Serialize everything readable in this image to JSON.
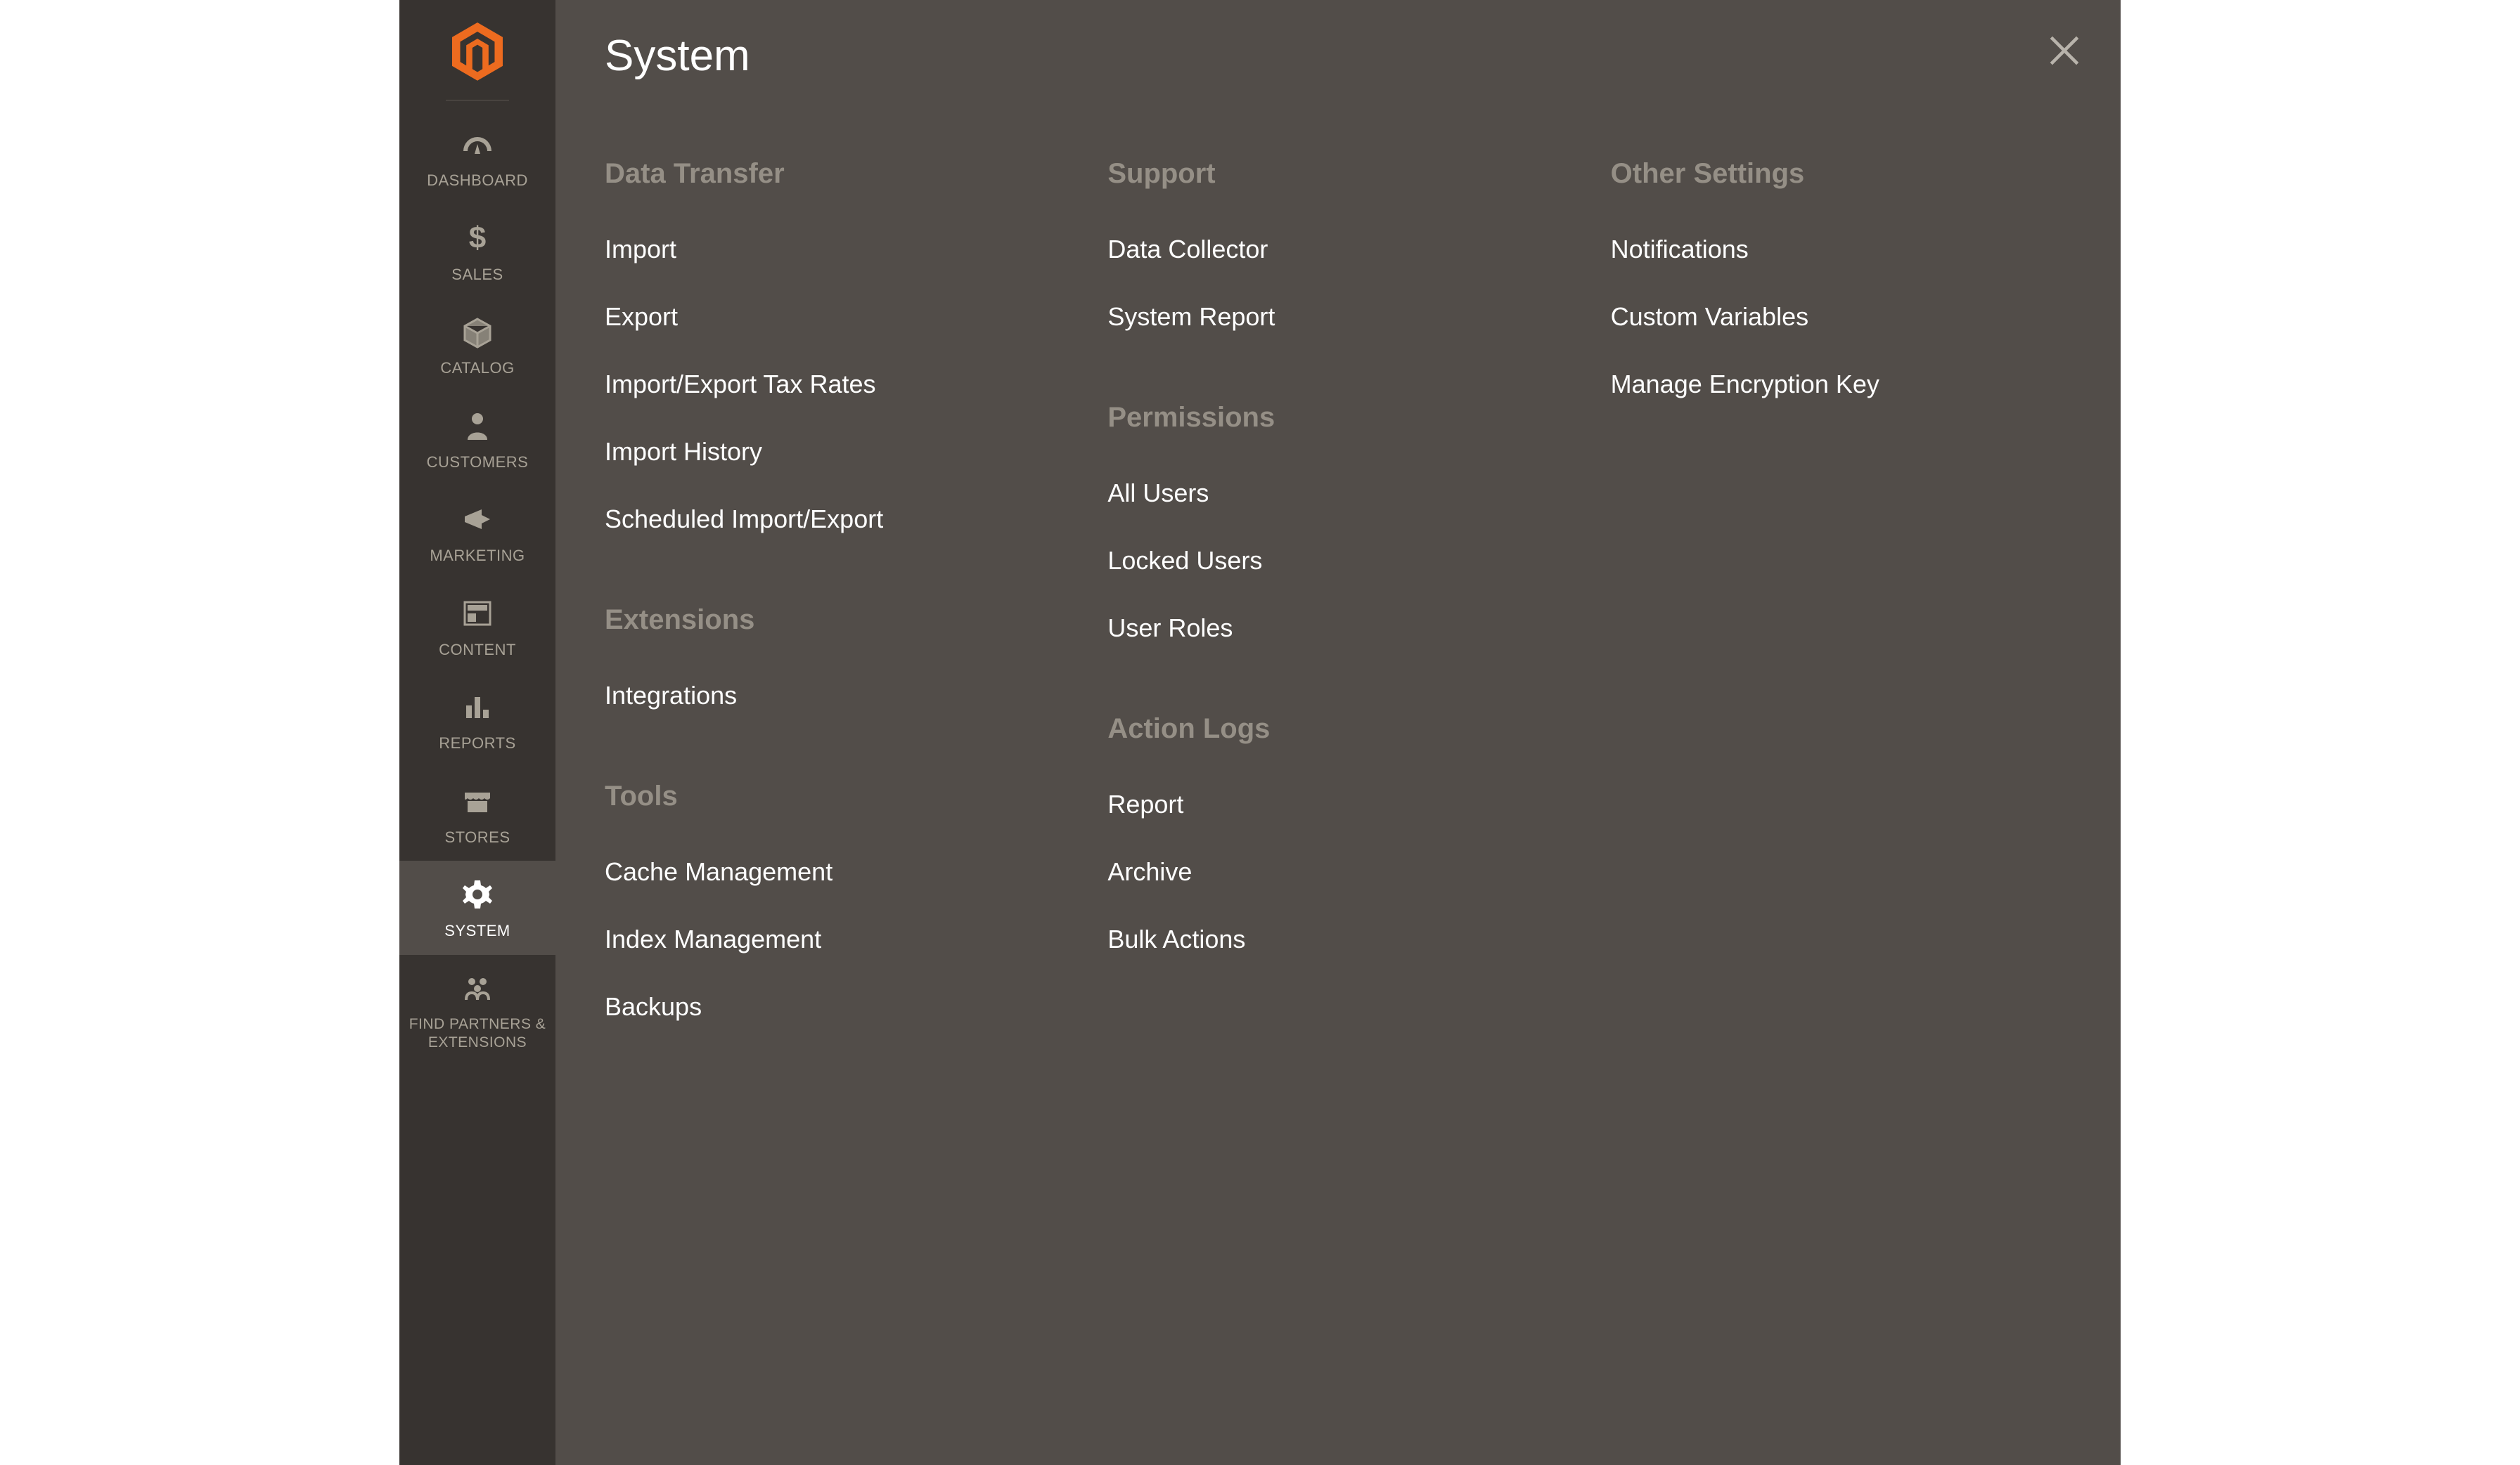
{
  "sidebar": {
    "items": [
      {
        "label": "DASHBOARD"
      },
      {
        "label": "SALES"
      },
      {
        "label": "CATALOG"
      },
      {
        "label": "CUSTOMERS"
      },
      {
        "label": "MARKETING"
      },
      {
        "label": "CONTENT"
      },
      {
        "label": "REPORTS"
      },
      {
        "label": "STORES"
      },
      {
        "label": "SYSTEM"
      },
      {
        "label": "FIND PARTNERS & EXTENSIONS"
      }
    ]
  },
  "flyout": {
    "title": "System",
    "columns": [
      {
        "sections": [
          {
            "heading": "Data Transfer",
            "links": [
              "Import",
              "Export",
              "Import/Export Tax Rates",
              "Import History",
              "Scheduled Import/Export"
            ]
          },
          {
            "heading": "Extensions",
            "links": [
              "Integrations"
            ]
          },
          {
            "heading": "Tools",
            "links": [
              "Cache Management",
              "Index Management",
              "Backups"
            ]
          }
        ]
      },
      {
        "sections": [
          {
            "heading": "Support",
            "links": [
              "Data Collector",
              "System Report"
            ]
          },
          {
            "heading": "Permissions",
            "links": [
              "All Users",
              "Locked Users",
              "User Roles"
            ]
          },
          {
            "heading": "Action Logs",
            "links": [
              "Report",
              "Archive",
              "Bulk Actions"
            ]
          }
        ]
      },
      {
        "sections": [
          {
            "heading": "Other Settings",
            "links": [
              "Notifications",
              "Custom Variables",
              "Manage Encryption Key"
            ]
          }
        ]
      }
    ]
  }
}
